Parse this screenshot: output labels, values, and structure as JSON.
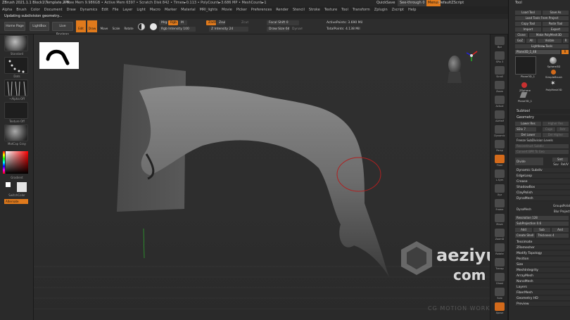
{
  "titlebar": {
    "app": "ZBrush 2021.1.1 Block1\\Template.ZPR",
    "mem": "• Free Mem 9.986GB • Active Mem 6397 • Scratch Disk 842 • Timer►0.113 • PolyCount►3.686 MP • MeshCount►1",
    "quicksave": "QuickSave",
    "seethrough": "See-through 0",
    "menus": "Menus",
    "script": "DefaultZScript"
  },
  "menubar": [
    "Alpha",
    "Brush",
    "Color",
    "Document",
    "Draw",
    "Dynamics",
    "Edit",
    "File",
    "Layer",
    "Light",
    "Macro",
    "Marker",
    "Material",
    "MRI_lights",
    "Movie",
    "Picker",
    "Preferences",
    "Render",
    "Stencil",
    "Stroke",
    "Texture",
    "Tool",
    "Transform",
    "Zplugin",
    "Zscript",
    "Help"
  ],
  "notice": "Updating subdivision geometry...",
  "toolbar": {
    "home": "Home Page",
    "lightbox": "LightBox",
    "livebool": "Live Boolean",
    "edit": "Edit",
    "draw": "Draw",
    "move": "Move",
    "scale": "Scale",
    "rotate": "Rotate",
    "mrgb": "Mrgb",
    "rgb": "Rgb",
    "m": "M",
    "zadd": "Zadd",
    "zsub": "Zsub",
    "zcut": "Zcut",
    "rgb_intensity": "Rgb Intensity 100",
    "z_intensity": "Z Intensity 24",
    "focal": "Focal Shift 0",
    "drawsize": "Draw Size 64",
    "dynamic": "Dynamic",
    "active": "ActivePoints: 3.690 Mil",
    "total": "TotalPoints: 4.138 Mil"
  },
  "left": {
    "standard": "Standard",
    "dots": "Dots",
    "alpha": "~Alpha Off",
    "texture": "Texture Off",
    "matcap": "MatCap Gray",
    "gradient": "Gradient",
    "switch": "SwitchColor",
    "alternate": "Alternate"
  },
  "shelf": [
    "Bpr",
    "SPix 3",
    "Scroll",
    "Zoom",
    "Actual",
    "AAHalf",
    "Dynamic",
    "Persp",
    "Floor",
    "L.Sym",
    "Xyz",
    "Frame",
    "Move",
    "ZoomD",
    "Rotate",
    "Transp",
    "Ghost",
    "Solo",
    "Xpose"
  ],
  "right": {
    "tool": "Tool",
    "load": "Load Tool",
    "save": "Save As",
    "loadproj": "Load Tools From Project",
    "copy": "Copy Tool",
    "paste": "Paste Tool",
    "import": "Import",
    "export": "Export",
    "clone": "Clone",
    "polymesh": "Make PolyMesh3D",
    "goz": "GoZ",
    "all": "All",
    "visible": "Visible",
    "r": "R",
    "lightbox": "Lightbox►Tools",
    "plane": "Plane3D_1_48",
    "rr": "R",
    "tools": [
      "Plane3D_1",
      "Sphere3D",
      "SimpleBrush",
      "ZSphere",
      "PolyMesh3D",
      "Plane3D_1"
    ],
    "subtool": "Subtool",
    "geometry": "Geometry",
    "lowerres": "Lower Res",
    "higherres": "Higher Res",
    "sdiv": "SDiv 7",
    "cage": "Cage",
    "rstr": "Rstr",
    "dellower": "Del Lower",
    "delhigher": "Del Higher",
    "freeze": "Freeze SubDivision Levels",
    "reconstruct": "Reconstruct Subdiv",
    "converttbpr": "Convert BPR To Geo",
    "divide": "Divide",
    "smt": "Smt",
    "suv": "Suv",
    "reuv": "ReUV",
    "items": [
      "Dynamic Subdiv",
      "EdgeLoop",
      "Crease",
      "ShadowBox",
      "ClayPolish",
      "DynaMesh"
    ],
    "dynamesh": "DynaMesh",
    "groups": "Groups",
    "polish": "Polish",
    "blur": "Blur",
    "project": "Project",
    "resolution": "Resolution 128",
    "subprojection": "SubProjection 0.6",
    "add": "Add",
    "sub": "Sub",
    "and": "And",
    "createshell": "Create Shell",
    "thickness": "Thickness 4",
    "items2": [
      "Tessimate",
      "ZRemesher",
      "Modify Topology",
      "Position",
      "Size",
      "MeshIntegrity"
    ],
    "items3": [
      "ArrayMesh",
      "NanoMesh",
      "Layers",
      "FiberMesh",
      "Geometry HD",
      "Preview"
    ]
  },
  "watermark": {
    "site": "aeziyuan",
    "dot": ".",
    "com": "com",
    "brand": "CG MOTION WORKSHOP"
  }
}
